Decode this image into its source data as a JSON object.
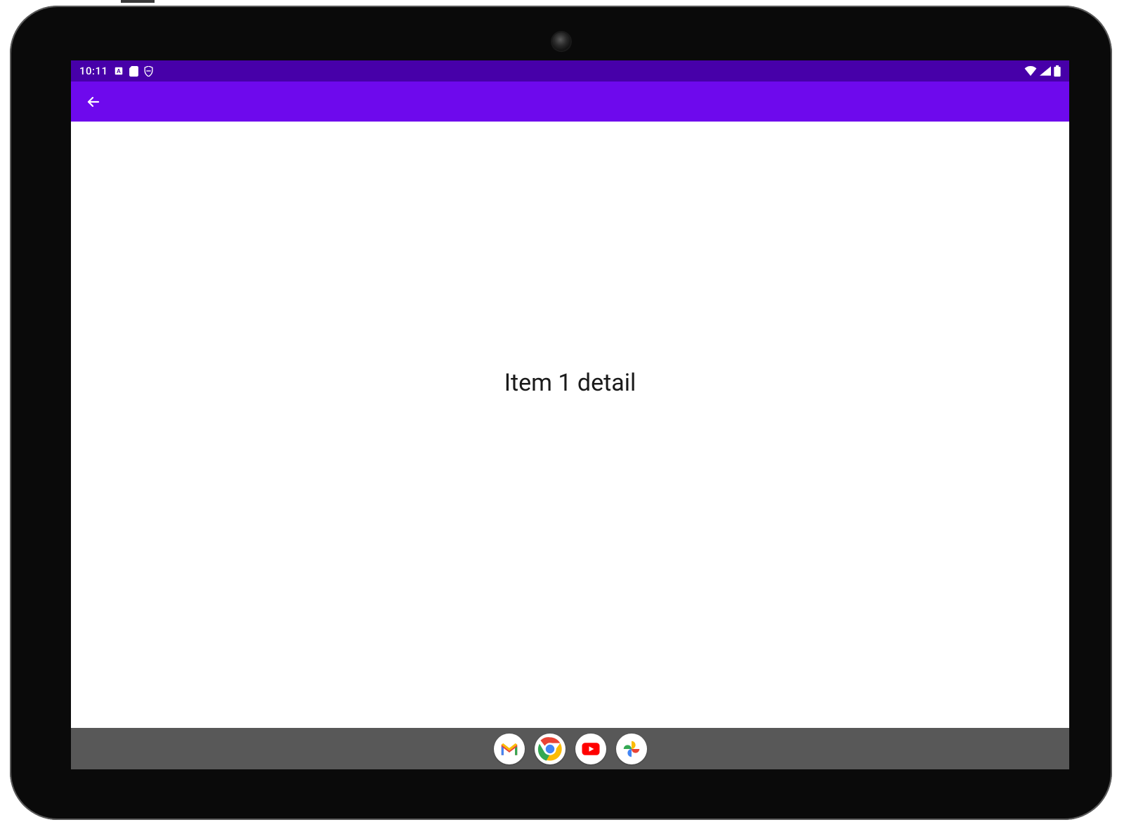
{
  "status_bar": {
    "clock": "10:11",
    "icons_left": [
      "a-box-icon",
      "sd-card-icon",
      "badge-icon"
    ],
    "icons_right": [
      "wifi-icon",
      "signal-icon",
      "battery-icon"
    ],
    "bg_color": "#4700a9"
  },
  "app_bar": {
    "bg_color": "#6e09ed",
    "back_icon": "arrow-back-icon"
  },
  "content": {
    "text": "Item 1 detail"
  },
  "taskbar": {
    "bg_color": "#585858",
    "apps": [
      {
        "name": "gmail-icon",
        "label": "Gmail"
      },
      {
        "name": "chrome-icon",
        "label": "Chrome"
      },
      {
        "name": "youtube-icon",
        "label": "YouTube"
      },
      {
        "name": "photos-icon",
        "label": "Photos"
      }
    ]
  }
}
